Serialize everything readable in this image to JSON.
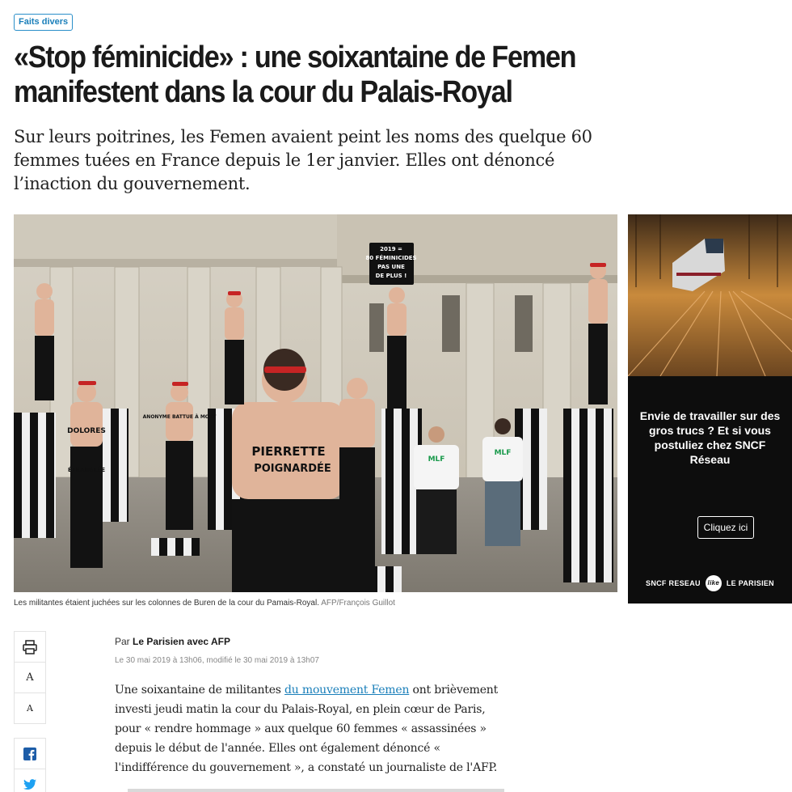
{
  "article": {
    "category": "Faits divers",
    "headline": "«Stop féminicide» : une soixantaine de Femen manifestent dans la cour du Palais-Royal",
    "standfirst": "Sur leurs poitrines, les Femen avaient peint les noms des quelque 60 femmes tuées en France depuis le 1er janvier. Elles ont dénoncé l’inaction du gouvernement.",
    "photo": {
      "sign_lines": [
        "2019 =",
        "80 FÉMINICIDES",
        "PAS UNE",
        "DE PLUS !"
      ],
      "body_texts": [
        "PIERRETTE",
        "POIGNARDÉE",
        "DOLORES",
        "ÉTRANGLÉE",
        "ANONYME BATTUE À MORT",
        "MLF",
        "MLF"
      ]
    },
    "caption": "Les militantes étaient juchées sur les colonnes de Buren de la cour du Pamais-Royal.",
    "caption_credit": "AFP/François Guillot",
    "byline_prefix": "Par",
    "byline_author": "Le Parisien avec AFP",
    "dateline": "Le 30 mai 2019 à 13h06, modifié le 30 mai 2019 à 13h07",
    "body": {
      "before_link": "Une soixantaine de militantes ",
      "link_text": "du mouvement Femen",
      "after_link": " ont brièvement investi jeudi matin la cour du Palais-Royal, en plein cœur de Paris, pour « rendre hommage » aux quelque 60 femmes « assassinées » depuis le début de l'année. Elles ont également dénoncé « l'indifférence du gouvernement », a constaté un journaliste de l'AFP."
    }
  },
  "share": {
    "print_icon": "printer-icon",
    "font_increase": "A",
    "font_decrease": "A",
    "facebook_icon": "facebook-icon",
    "twitter_icon": "twitter-icon"
  },
  "ad": {
    "headline": "Envie de travailler sur des gros trucs ? Et si vous postuliez chez SNCF Réseau",
    "button": "Cliquez ici",
    "brand_left": "SNCF RESEAU",
    "brand_middle": "like",
    "brand_right": "LE PARISIEN"
  },
  "colors": {
    "accent": "#1a7fba",
    "text": "#1a1a1a",
    "ad_background": "#0d0d0d"
  }
}
